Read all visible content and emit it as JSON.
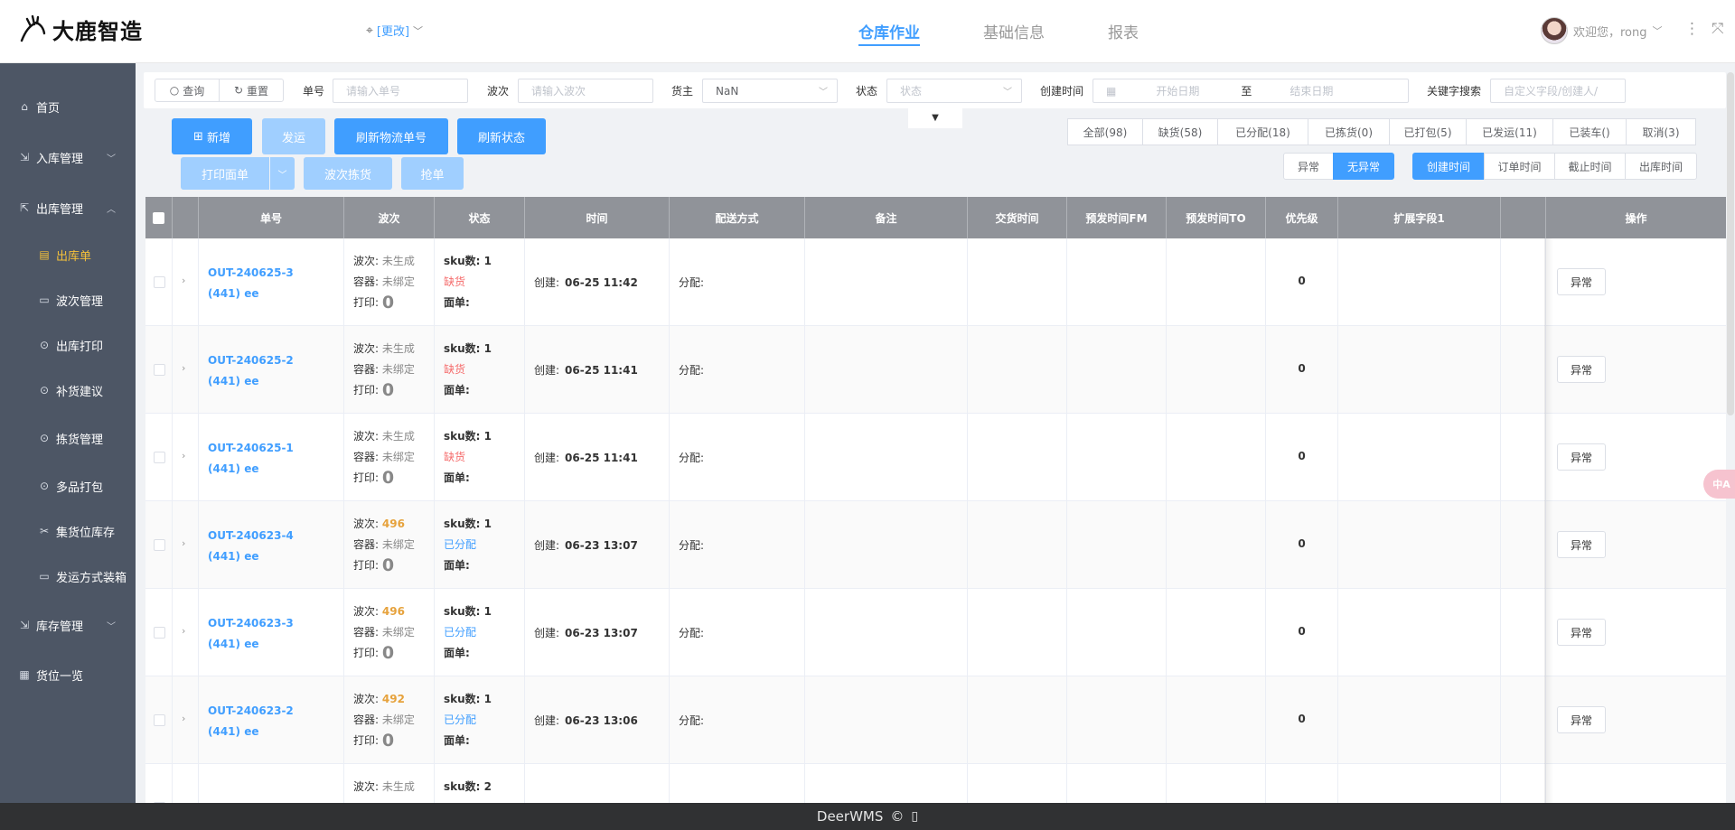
{
  "header": {
    "logo_text": "大鹿智造",
    "location_label": "[更改]",
    "nav": [
      "仓库作业",
      "基础信息",
      "报表"
    ],
    "greeting": "欢迎您，rong"
  },
  "sidebar": {
    "home": "首页",
    "inbound": "入库管理",
    "outbound": "出库管理",
    "outbound_order": "出库单",
    "wave": "波次管理",
    "print": "出库打印",
    "replenish": "补货建议",
    "picking": "拣货管理",
    "multipack": "多品打包",
    "collect": "集货位库存",
    "shipbox": "发运方式装箱",
    "inventory": "库存管理",
    "locations": "货位一览"
  },
  "filters": {
    "query_btn": "查询",
    "reset_btn": "重置",
    "order_label": "单号",
    "order_placeholder": "请输入单号",
    "wave_label": "波次",
    "wave_placeholder": "请输入波次",
    "owner_label": "货主",
    "owner_value": "NaN",
    "status_label": "状态",
    "status_placeholder": "状态",
    "created_label": "创建时间",
    "start_placeholder": "开始日期",
    "to": "至",
    "end_placeholder": "结束日期",
    "keyword_label": "关键字搜索",
    "keyword_placeholder": "自定义字段/创建人/"
  },
  "actions": {
    "add": "新增",
    "ship": "发运",
    "refresh_logistics": "刷新物流单号",
    "refresh_status": "刷新状态",
    "print_sheet": "打印面单",
    "wave_pick": "波次拣货",
    "grab": "抢单"
  },
  "status_tabs": [
    "全部(98)",
    "缺货(58)",
    "已分配(18)",
    "已拣货(0)",
    "已打包(5)",
    "已发运(11)",
    "已装车()",
    "取消(3)"
  ],
  "anomaly_tabs": [
    "异常",
    "无异常"
  ],
  "time_tabs": [
    "创建时间",
    "订单时间",
    "截止时间",
    "出库时间"
  ],
  "table": {
    "columns": [
      "单号",
      "波次",
      "状态",
      "时间",
      "配送方式",
      "备注",
      "交货时间",
      "预发时间FM",
      "预发时间TO",
      "优先级",
      "扩展字段1",
      "操作"
    ],
    "labels": {
      "wave": "波次:",
      "container": "容器:",
      "print": "打印:",
      "sku": "sku数:",
      "sheet": "面单:",
      "created": "创建:",
      "assign": "分配:"
    },
    "op_button": "异常",
    "rows": [
      {
        "order": "OUT-240625-3",
        "sub": "(441) ee",
        "wave": "未生成",
        "container": "未绑定",
        "print": "0",
        "sku": "1",
        "status": "缺货",
        "created": "06-25 11:42",
        "priority": "0"
      },
      {
        "order": "OUT-240625-2",
        "sub": "(441) ee",
        "wave": "未生成",
        "container": "未绑定",
        "print": "0",
        "sku": "1",
        "status": "缺货",
        "created": "06-25 11:41",
        "priority": "0"
      },
      {
        "order": "OUT-240625-1",
        "sub": "(441) ee",
        "wave": "未生成",
        "container": "未绑定",
        "print": "0",
        "sku": "1",
        "status": "缺货",
        "created": "06-25 11:41",
        "priority": "0"
      },
      {
        "order": "OUT-240623-4",
        "sub": "(441) ee",
        "wave": "496",
        "container": "未绑定",
        "print": "0",
        "sku": "1",
        "status": "已分配",
        "created": "06-23 13:07",
        "priority": "0"
      },
      {
        "order": "OUT-240623-3",
        "sub": "(441) ee",
        "wave": "496",
        "container": "未绑定",
        "print": "0",
        "sku": "1",
        "status": "已分配",
        "created": "06-23 13:07",
        "priority": "0"
      },
      {
        "order": "OUT-240623-2",
        "sub": "(441) ee",
        "wave": "492",
        "container": "未绑定",
        "print": "0",
        "sku": "1",
        "status": "已分配",
        "created": "06-23 13:06",
        "priority": "0"
      },
      {
        "order": "",
        "sub": "",
        "wave": "未生成",
        "container": "",
        "print": "",
        "sku": "2",
        "status": "",
        "created": "",
        "priority": ""
      }
    ]
  },
  "float_badge": "中A",
  "footer": {
    "brand": "DeerWMS",
    "copyright": "©"
  },
  "colors": {
    "primary": "#409eff",
    "sidebar": "#4d5665",
    "active_menu": "#f5c13a",
    "danger": "#f56c6c",
    "warning": "#e6a23c"
  }
}
